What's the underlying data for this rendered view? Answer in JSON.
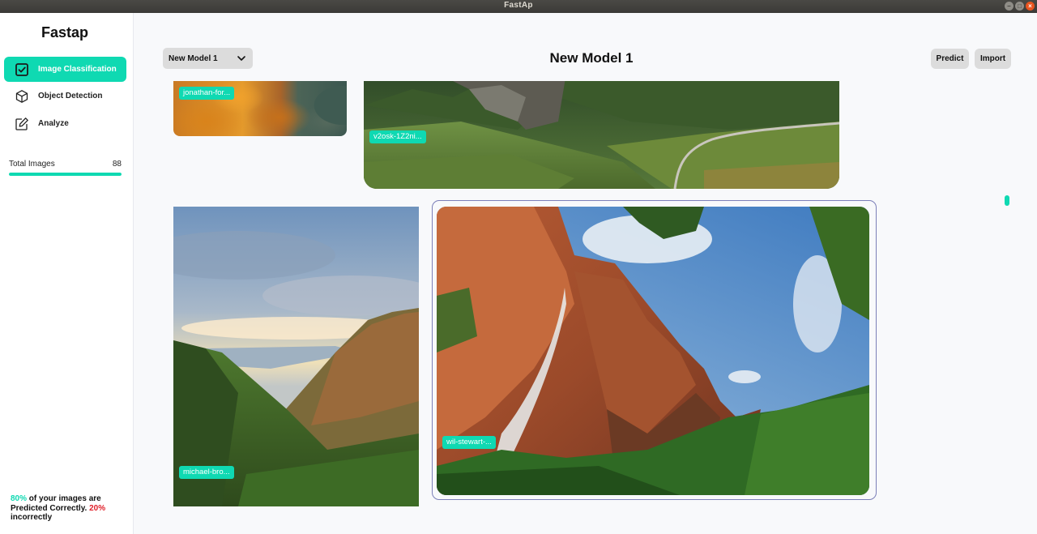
{
  "window": {
    "title": "FastAp"
  },
  "sidebar": {
    "brand": "Fastap",
    "items": [
      {
        "label": "Image Classification",
        "icon": "checkbox-icon",
        "active": true
      },
      {
        "label": "Object Detection",
        "icon": "cube-icon",
        "active": false
      },
      {
        "label": "Analyze",
        "icon": "edit-icon",
        "active": false
      }
    ],
    "total": {
      "label": "Total Images",
      "count": "88",
      "progress_fraction": 1.0
    },
    "accuracy": {
      "correct_pct": "80%",
      "correct_text": " of your images are Predicted Correctly. ",
      "incorrect_pct": "20%",
      "incorrect_text": " incorrectly"
    }
  },
  "header": {
    "model_select": "New Model 1",
    "title": "New Model 1",
    "predict_label": "Predict",
    "import_label": "Import"
  },
  "images": [
    {
      "label": "jonathan-for..."
    },
    {
      "label": "v2osk-1Z2ni..."
    },
    {
      "label": "michael-bro..."
    },
    {
      "label": "wil-stewart-...",
      "selected": true
    }
  ],
  "colors": {
    "accent": "#0fd9b2",
    "incorrect": "#e0202a",
    "selection_border": "#7b7fb8"
  }
}
